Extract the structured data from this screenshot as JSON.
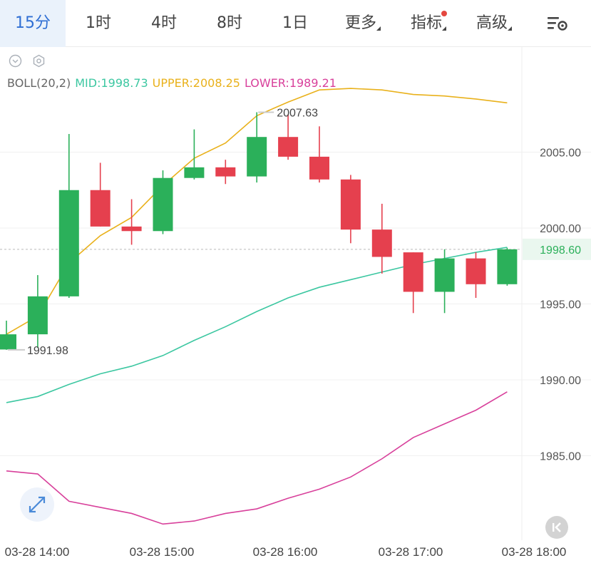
{
  "tabs": [
    {
      "label": "15分",
      "active": true
    },
    {
      "label": "1时"
    },
    {
      "label": "4时"
    },
    {
      "label": "8时"
    },
    {
      "label": "1日"
    },
    {
      "label": "更多",
      "dropdown": true
    },
    {
      "label": "指标",
      "dropdown": true,
      "badge": true
    },
    {
      "label": "高级",
      "dropdown": true
    }
  ],
  "toolbar": {
    "settings_icon": "chart-settings-icon"
  },
  "mini_icons": [
    "collapse-circle-icon",
    "hexagon-settings-icon"
  ],
  "legend": {
    "boll": "BOLL(20,2)",
    "mid": "MID:1998.73",
    "upper": "UPPER:2008.25",
    "lower": "LOWER:1989.21"
  },
  "colors": {
    "up": "#2bb05a",
    "down": "#e5404e",
    "mid": "#3cc7a1",
    "upper": "#e9b11b",
    "lower": "#d8409b",
    "accent": "#2f6fd4",
    "price_tag": "#2bb05a"
  },
  "current_price": "1998.60",
  "markers": {
    "high": "2007.63",
    "low": "1991.98"
  },
  "buttons": {
    "expand_icon": "expand-arrows-icon",
    "back_icon": "skip-back-icon"
  },
  "chart_data": {
    "type": "candlestick",
    "title": "",
    "interval": "15分",
    "indicator": "BOLL(20,2)",
    "ylim": [
      1980.5,
      2011.5
    ],
    "y_ticks": [
      "2005.00",
      "2000.00",
      "1995.00",
      "1990.00",
      "1985.00"
    ],
    "y_tick_values": [
      2005,
      2000,
      1995,
      1990,
      1985
    ],
    "x_tick_labels": [
      "03-28 14:00",
      "03-28 15:00",
      "03-28 16:00",
      "03-28 17:00",
      "03-28 18:00"
    ],
    "candles": [
      {
        "o": 1992.0,
        "h": 1993.9,
        "l": 1991.98,
        "c": 1993.0
      },
      {
        "o": 1993.0,
        "h": 1996.9,
        "l": 1992.1,
        "c": 1995.5
      },
      {
        "o": 1995.5,
        "h": 2006.2,
        "l": 1995.4,
        "c": 2002.5
      },
      {
        "o": 2002.5,
        "h": 2004.3,
        "l": 2000.1,
        "c": 2000.1
      },
      {
        "o": 2000.1,
        "h": 2001.9,
        "l": 1998.9,
        "c": 1999.8
      },
      {
        "o": 1999.8,
        "h": 2003.8,
        "l": 1999.6,
        "c": 2003.3
      },
      {
        "o": 2003.3,
        "h": 2006.5,
        "l": 2003.2,
        "c": 2004.0
      },
      {
        "o": 2004.0,
        "h": 2004.5,
        "l": 2002.9,
        "c": 2003.4
      },
      {
        "o": 2003.4,
        "h": 2007.63,
        "l": 2003.0,
        "c": 2006.0
      },
      {
        "o": 2006.0,
        "h": 2007.5,
        "l": 2004.5,
        "c": 2004.7
      },
      {
        "o": 2004.7,
        "h": 2006.7,
        "l": 2003.0,
        "c": 2003.2
      },
      {
        "o": 2003.2,
        "h": 2003.5,
        "l": 1999.0,
        "c": 1999.9
      },
      {
        "o": 1999.9,
        "h": 2001.6,
        "l": 1997.0,
        "c": 1998.1
      },
      {
        "o": 1998.4,
        "h": 1998.4,
        "l": 1994.4,
        "c": 1995.8
      },
      {
        "o": 1995.8,
        "h": 1998.6,
        "l": 1994.4,
        "c": 1998.0
      },
      {
        "o": 1998.0,
        "h": 1998.4,
        "l": 1995.4,
        "c": 1996.3
      },
      {
        "o": 1996.3,
        "h": 1998.7,
        "l": 1996.2,
        "c": 1998.6
      }
    ],
    "series": [
      {
        "name": "UPPER",
        "values": [
          1993.0,
          1994.2,
          1997.7,
          1999.5,
          2000.7,
          2002.8,
          2004.6,
          2005.6,
          2007.4,
          2008.3,
          2009.1,
          2009.2,
          2009.1,
          2008.8,
          2008.7,
          2008.5,
          2008.25
        ]
      },
      {
        "name": "MID",
        "values": [
          1988.5,
          1988.9,
          1989.7,
          1990.4,
          1990.9,
          1991.6,
          1992.6,
          1993.5,
          1994.5,
          1995.4,
          1996.1,
          1996.6,
          1997.1,
          1997.6,
          1998.0,
          1998.4,
          1998.73
        ]
      },
      {
        "name": "LOWER",
        "values": [
          1984.0,
          1983.8,
          1982.0,
          1981.6,
          1981.2,
          1980.5,
          1980.7,
          1981.2,
          1981.5,
          1982.2,
          1982.8,
          1983.6,
          1984.8,
          1986.2,
          1987.1,
          1988.0,
          1989.21
        ]
      }
    ]
  }
}
